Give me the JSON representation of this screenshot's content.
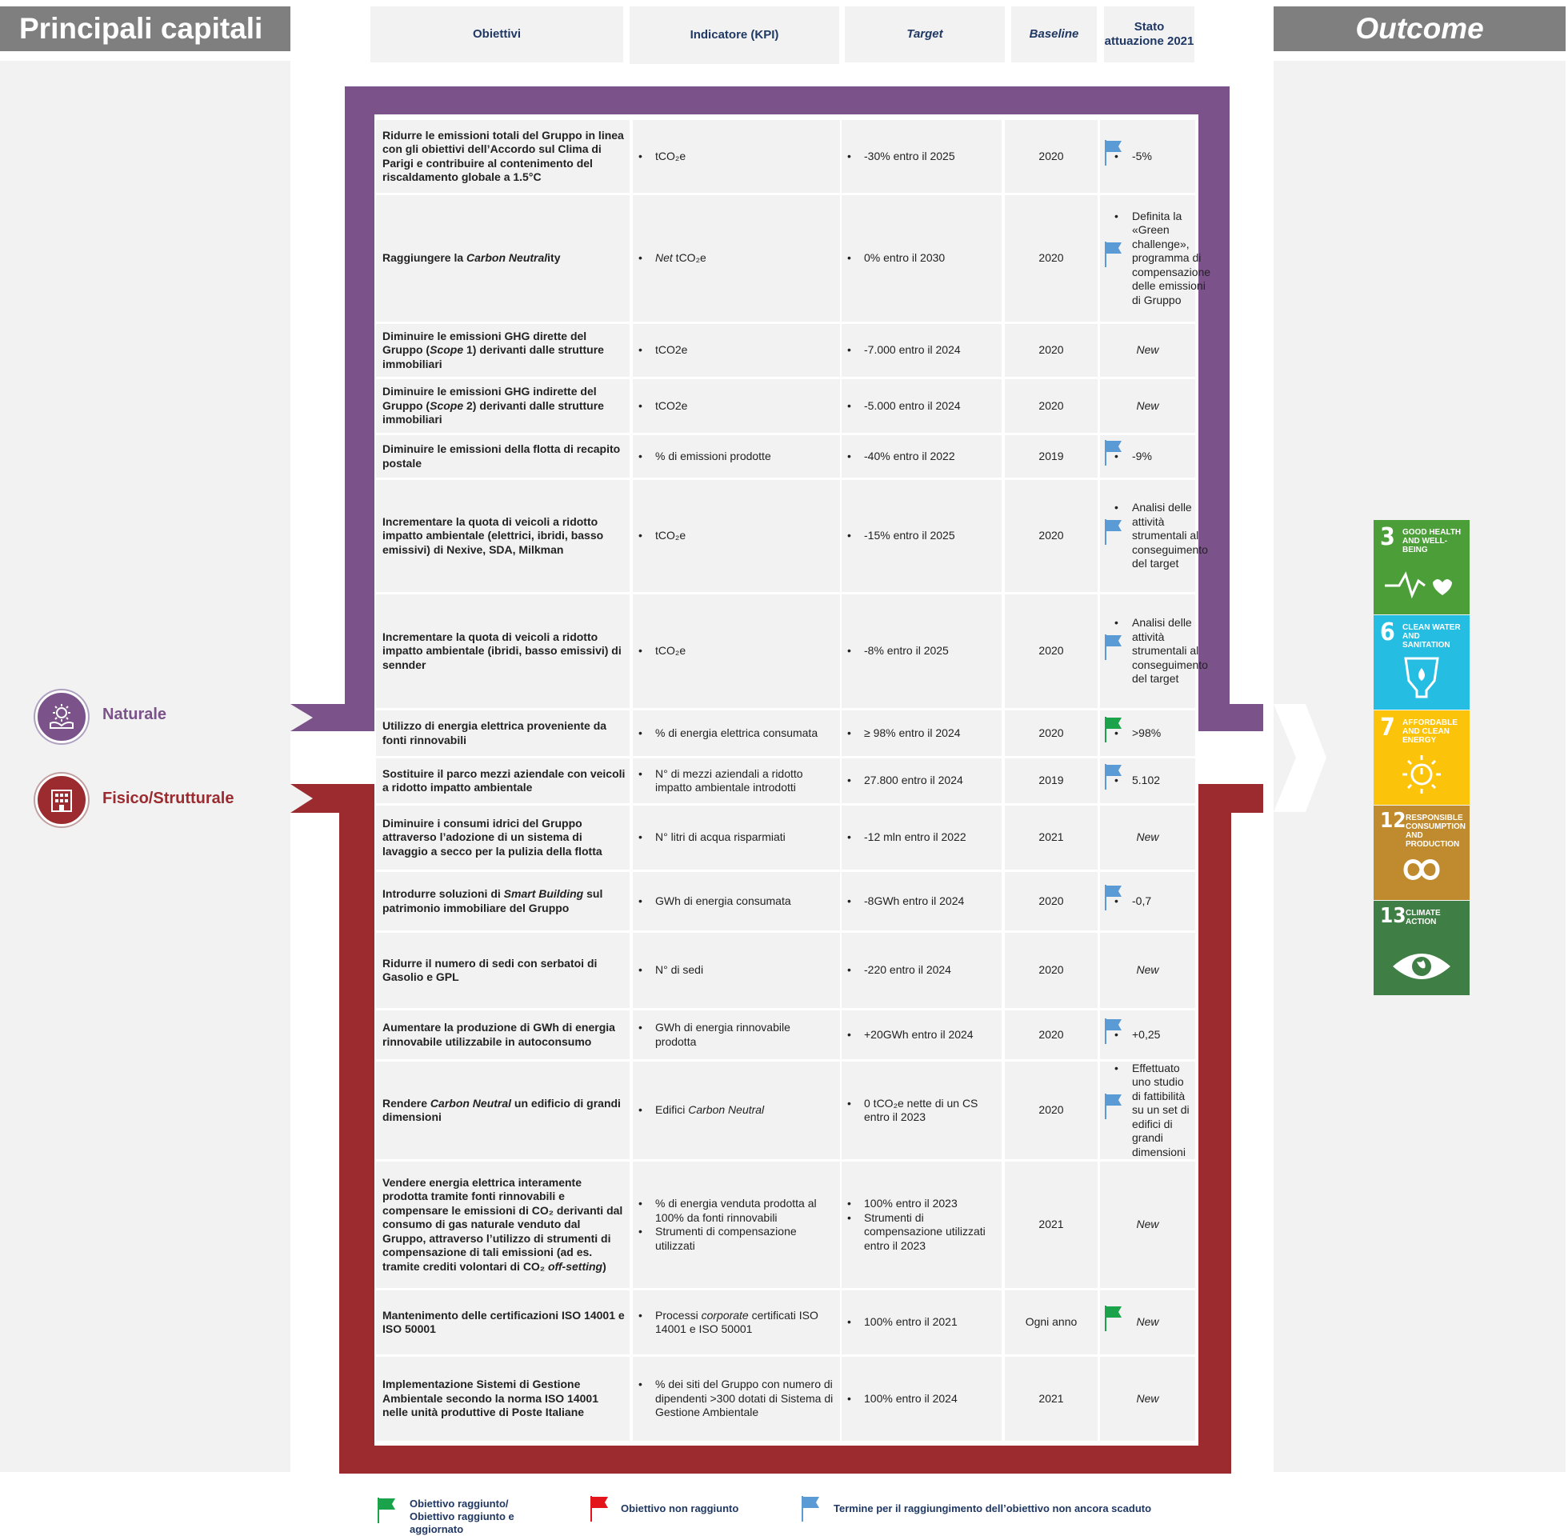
{
  "header": {
    "left_title": "Principali capitali",
    "right_title": "Outcome"
  },
  "columns": {
    "obiettivi": "Obiettivi",
    "kpi": "Indicatore (KPI)",
    "target": "Target",
    "baseline": "Baseline",
    "stato": "Stato attuazione 2021"
  },
  "capitals": {
    "naturale": "Naturale",
    "fisico": "Fisico/Strutturale"
  },
  "colors": {
    "purple": "#7b528a",
    "red": "#9b2b2f",
    "flag_green": "#1aa34a",
    "flag_red": "#e3141a",
    "flag_blue": "#5b9bd5"
  },
  "rows": [
    {
      "obj": "Ridurre le emissioni totali del Gruppo in linea con gli obiettivi dell’Accordo sul Clima di Parigi e contribuire al contenimento del riscaldamento globale a 1.5°C",
      "kpi": "tCO₂e",
      "target": "-30% entro il 2025",
      "baseline": "2020",
      "stato": "-5%",
      "flag": "blue"
    },
    {
      "obj": "Raggiungere la Carbon Neutrality",
      "kpi": "Net tCO₂e",
      "target": "0% entro il 2030",
      "baseline": "2020",
      "stato": "Definita la «Green challenge», programma di compensazione delle emissioni di Gruppo",
      "flag": "blue"
    },
    {
      "obj": "Diminuire le emissioni GHG dirette del Gruppo (Scope 1) derivanti dalle strutture immobiliari",
      "kpi": "tCO2e",
      "target": "-7.000 entro il 2024",
      "baseline": "2020",
      "stato": "New",
      "flag": ""
    },
    {
      "obj": "Diminuire le emissioni GHG indirette del Gruppo (Scope 2) derivanti dalle strutture immobiliari",
      "kpi": "tCO2e",
      "target": "-5.000 entro il 2024",
      "baseline": "2020",
      "stato": "New",
      "flag": ""
    },
    {
      "obj": "Diminuire le emissioni della flotta di recapito postale",
      "kpi": "% di emissioni prodotte",
      "target": "-40% entro il 2022",
      "baseline": "2019",
      "stato": "-9%",
      "flag": "blue"
    },
    {
      "obj": "Incrementare la quota di veicoli a ridotto impatto ambientale (elettrici, ibridi, basso emissivi) di Nexive, SDA, Milkman",
      "kpi": "tCO₂e",
      "target": "-15% entro il 2025",
      "baseline": "2020",
      "stato": "Analisi delle attività strumentali al conseguimento del target",
      "flag": "blue"
    },
    {
      "obj": "Incrementare la quota di veicoli a ridotto impatto ambientale (ibridi, basso emissivi) di sennder",
      "kpi": "tCO₂e",
      "target": "-8% entro il 2025",
      "baseline": "2020",
      "stato": "Analisi delle attività strumentali al conseguimento del target",
      "flag": "blue"
    },
    {
      "obj": "Utilizzo di energia elettrica proveniente da fonti rinnovabili",
      "kpi": "% di energia elettrica consumata",
      "target": "≥ 98% entro il 2024",
      "baseline": "2020",
      "stato": ">98%",
      "flag": "green"
    },
    {
      "obj": "Sostituire il parco mezzi aziendale con veicoli a ridotto impatto ambientale",
      "kpi": "N° di mezzi aziendali a ridotto impatto ambientale introdotti",
      "target": "27.800 entro il 2024",
      "baseline": "2019",
      "stato": "5.102",
      "flag": "blue"
    },
    {
      "obj": "Diminuire i consumi idrici del Gruppo attraverso l’adozione di un sistema di lavaggio a secco per la pulizia della flotta",
      "kpi": "N° litri di acqua risparmiati",
      "target": "-12 mln entro il 2022",
      "baseline": "2021",
      "stato": "New",
      "flag": ""
    },
    {
      "obj": "Introdurre soluzioni di Smart Building sul patrimonio immobiliare del Gruppo",
      "kpi": "GWh di energia consumata",
      "target": "-8GWh entro il 2024",
      "baseline": "2020",
      "stato": "-0,7",
      "flag": "blue"
    },
    {
      "obj": "Ridurre il numero di sedi con serbatoi di Gasolio e GPL",
      "kpi": "N° di sedi",
      "target": "-220 entro il 2024",
      "baseline": "2020",
      "stato": "New",
      "flag": ""
    },
    {
      "obj": "Aumentare la produzione di GWh di energia rinnovabile utilizzabile in autoconsumo",
      "kpi": "GWh di energia rinnovabile prodotta",
      "target": "+20GWh entro il 2024",
      "baseline": "2020",
      "stato": "+0,25",
      "flag": "blue"
    },
    {
      "obj": "Rendere Carbon Neutral un edificio di grandi dimensioni",
      "kpi": "Edifici Carbon Neutral",
      "target": "0 tCO₂e nette di un CS entro il 2023",
      "baseline": "2020",
      "stato": "Effettuato uno studio di fattibilità su un set di edifici di grandi dimensioni",
      "flag": "blue"
    },
    {
      "obj": "Vendere energia elettrica interamente prodotta tramite fonti rinnovabili e compensare le emissioni di CO₂ derivanti dal consumo di gas naturale venduto dal Gruppo, attraverso l’utilizzo di strumenti di compensazione di tali emissioni (ad es. tramite crediti volontari di CO₂ off-setting)",
      "kpi": "% di energia venduta prodotta al 100% da fonti rinnovabili",
      "kpi2": "Strumenti di compensazione utilizzati",
      "target": "100% entro il 2023",
      "target2": "Strumenti di compensazione utilizzati entro il 2023",
      "baseline": "2021",
      "stato": "New",
      "flag": ""
    },
    {
      "obj": "Mantenimento delle certificazioni ISO 14001 e ISO 50001",
      "kpi": "Processi corporate certificati ISO 14001 e ISO 50001",
      "target": "100% entro il 2021",
      "baseline": "Ogni anno",
      "stato": "New",
      "flag": "green"
    },
    {
      "obj": "Implementazione Sistemi di Gestione Ambientale secondo la norma ISO 14001 nelle unità produttive di Poste Italiane",
      "kpi": "% dei siti del Gruppo con numero di dipendenti >300 dotati di Sistema di Gestione Ambientale",
      "target": "100% entro il 2024",
      "baseline": "2021",
      "stato": "New",
      "flag": ""
    }
  ],
  "bullet": "•",
  "sdgs": [
    {
      "num": "3",
      "title": "GOOD HEALTH AND WELL-BEING",
      "color": "#4c9f38",
      "icon": "heartbeat-icon"
    },
    {
      "num": "6",
      "title": "CLEAN WATER AND SANITATION",
      "color": "#26bde2",
      "icon": "water-drop-icon"
    },
    {
      "num": "7",
      "title": "AFFORDABLE AND CLEAN ENERGY",
      "color": "#fcc30b",
      "icon": "sun-power-icon"
    },
    {
      "num": "12",
      "title": "RESPONSIBLE CONSUMPTION AND PRODUCTION",
      "color": "#bf8b2e",
      "icon": "infinity-icon"
    },
    {
      "num": "13",
      "title": "CLIMATE ACTION",
      "color": "#3f7e44",
      "icon": "eye-globe-icon"
    }
  ],
  "legend": {
    "green": "Obiettivo raggiunto/ Obiettivo raggiunto e aggiornato",
    "red": "Obiettivo non raggiunto",
    "blue": "Termine per il raggiungimento dell’obiettivo non ancora scaduto"
  }
}
